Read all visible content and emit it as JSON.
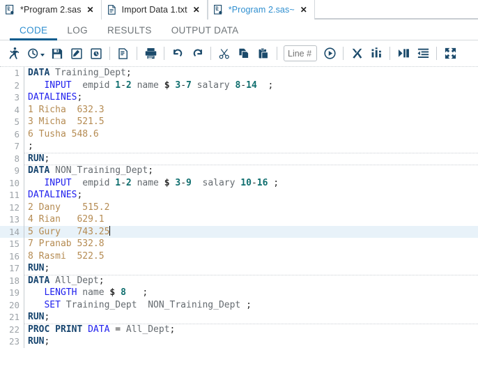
{
  "window": {
    "file_tabs": [
      {
        "label": "*Program 2.sas",
        "icon": "sas-file-icon",
        "close": "✕",
        "active": false
      },
      {
        "label": "Import Data 1.txt",
        "icon": "text-file-icon",
        "close": "✕",
        "active": false
      },
      {
        "label": "*Program 2.sas~",
        "icon": "sas-file-icon",
        "close": "✕",
        "active": true
      }
    ]
  },
  "view_tabs": [
    {
      "label": "CODE",
      "active": true
    },
    {
      "label": "LOG",
      "active": false
    },
    {
      "label": "RESULTS",
      "active": false
    },
    {
      "label": "OUTPUT DATA",
      "active": false
    }
  ],
  "toolbar": {
    "buttons": [
      {
        "name": "run-icon",
        "title": "Run"
      },
      {
        "name": "recent-history-icon",
        "title": "Recent"
      },
      {
        "name": "save-icon",
        "title": "Save"
      },
      {
        "name": "save-as-icon",
        "title": "Save As"
      },
      {
        "name": "code-snippet-icon",
        "title": "Snippets"
      },
      {
        "name": "properties-icon",
        "title": "Properties"
      },
      {
        "name": "print-icon",
        "title": "Print"
      },
      {
        "name": "undo-icon",
        "title": "Undo"
      },
      {
        "name": "redo-icon",
        "title": "Redo"
      },
      {
        "name": "cut-icon",
        "title": "Cut"
      },
      {
        "name": "copy-icon",
        "title": "Copy"
      },
      {
        "name": "paste-icon",
        "title": "Paste"
      },
      {
        "name": "go-to-line-icon",
        "title": "Go to line"
      },
      {
        "name": "clear-all-icon",
        "title": "Clear all"
      },
      {
        "name": "analyze-program-icon",
        "title": "Analyze program"
      },
      {
        "name": "add-tab-indent-icon",
        "title": "Indent"
      },
      {
        "name": "format-code-icon",
        "title": "Format code"
      },
      {
        "name": "maximize-view-icon",
        "title": "Maximize view"
      }
    ],
    "line_placeholder": "Line #",
    "line_value": ""
  },
  "editor": {
    "current_line": 14,
    "cursor_line": 14,
    "lines": [
      {
        "n": 1,
        "sep": false,
        "cur": false,
        "tokens": [
          {
            "t": "DATA",
            "c": "k-major"
          },
          {
            "t": " ",
            "c": ""
          },
          {
            "t": "Training_Dept",
            "c": "k-id"
          },
          {
            "t": ";",
            "c": "k-punct"
          }
        ]
      },
      {
        "n": 2,
        "sep": false,
        "cur": false,
        "tokens": [
          {
            "t": "   ",
            "c": ""
          },
          {
            "t": "INPUT",
            "c": "k-stmt"
          },
          {
            "t": "  ",
            "c": ""
          },
          {
            "t": "empid",
            "c": "k-id"
          },
          {
            "t": " ",
            "c": ""
          },
          {
            "t": "1",
            "c": "k-num"
          },
          {
            "t": "-",
            "c": "k-punct"
          },
          {
            "t": "2",
            "c": "k-num"
          },
          {
            "t": " ",
            "c": ""
          },
          {
            "t": "name",
            "c": "k-id"
          },
          {
            "t": " ",
            "c": ""
          },
          {
            "t": "$",
            "c": "k-dollar"
          },
          {
            "t": " ",
            "c": ""
          },
          {
            "t": "3",
            "c": "k-num"
          },
          {
            "t": "-",
            "c": "k-punct"
          },
          {
            "t": "7",
            "c": "k-num"
          },
          {
            "t": " ",
            "c": ""
          },
          {
            "t": "salary",
            "c": "k-id"
          },
          {
            "t": " ",
            "c": ""
          },
          {
            "t": "8",
            "c": "k-num"
          },
          {
            "t": "-",
            "c": "k-punct"
          },
          {
            "t": "14",
            "c": "k-num"
          },
          {
            "t": "  ",
            "c": ""
          },
          {
            "t": ";",
            "c": "k-punct"
          }
        ]
      },
      {
        "n": 3,
        "sep": false,
        "cur": false,
        "tokens": [
          {
            "t": "DATALINES",
            "c": "k-stmt"
          },
          {
            "t": ";",
            "c": "k-punct"
          }
        ]
      },
      {
        "n": 4,
        "sep": false,
        "cur": false,
        "tokens": [
          {
            "t": "1 Richa  632.3",
            "c": "k-data"
          }
        ]
      },
      {
        "n": 5,
        "sep": false,
        "cur": false,
        "tokens": [
          {
            "t": "3 Micha  521.5",
            "c": "k-data"
          }
        ]
      },
      {
        "n": 6,
        "sep": false,
        "cur": false,
        "tokens": [
          {
            "t": "6 Tusha 548.6",
            "c": "k-data"
          }
        ]
      },
      {
        "n": 7,
        "sep": false,
        "cur": false,
        "tokens": [
          {
            "t": ";",
            "c": "k-punct"
          }
        ]
      },
      {
        "n": 8,
        "sep": true,
        "cur": false,
        "tokens": [
          {
            "t": "RUN",
            "c": "k-major"
          },
          {
            "t": ";",
            "c": "k-punct"
          }
        ]
      },
      {
        "n": 9,
        "sep": true,
        "cur": false,
        "tokens": [
          {
            "t": "DATA",
            "c": "k-major"
          },
          {
            "t": " ",
            "c": ""
          },
          {
            "t": "NON_Training_Dept",
            "c": "k-id"
          },
          {
            "t": ";",
            "c": "k-punct"
          }
        ]
      },
      {
        "n": 10,
        "sep": false,
        "cur": false,
        "tokens": [
          {
            "t": "   ",
            "c": ""
          },
          {
            "t": "INPUT",
            "c": "k-stmt"
          },
          {
            "t": "  ",
            "c": ""
          },
          {
            "t": "empid",
            "c": "k-id"
          },
          {
            "t": " ",
            "c": ""
          },
          {
            "t": "1",
            "c": "k-num"
          },
          {
            "t": "-",
            "c": "k-punct"
          },
          {
            "t": "2",
            "c": "k-num"
          },
          {
            "t": " ",
            "c": ""
          },
          {
            "t": "name",
            "c": "k-id"
          },
          {
            "t": " ",
            "c": ""
          },
          {
            "t": "$",
            "c": "k-dollar"
          },
          {
            "t": " ",
            "c": ""
          },
          {
            "t": "3",
            "c": "k-num"
          },
          {
            "t": "-",
            "c": "k-punct"
          },
          {
            "t": "9",
            "c": "k-num"
          },
          {
            "t": "  ",
            "c": ""
          },
          {
            "t": "salary",
            "c": "k-id"
          },
          {
            "t": " ",
            "c": ""
          },
          {
            "t": "10",
            "c": "k-num"
          },
          {
            "t": "-",
            "c": "k-punct"
          },
          {
            "t": "16",
            "c": "k-num"
          },
          {
            "t": " ",
            "c": ""
          },
          {
            "t": ";",
            "c": "k-punct"
          }
        ]
      },
      {
        "n": 11,
        "sep": false,
        "cur": false,
        "tokens": [
          {
            "t": "DATALINES",
            "c": "k-stmt"
          },
          {
            "t": ";",
            "c": "k-punct"
          }
        ]
      },
      {
        "n": 12,
        "sep": false,
        "cur": false,
        "tokens": [
          {
            "t": "2 Dany    515.2",
            "c": "k-data"
          }
        ]
      },
      {
        "n": 13,
        "sep": false,
        "cur": false,
        "tokens": [
          {
            "t": "4 Rian   629.1",
            "c": "k-data"
          }
        ]
      },
      {
        "n": 14,
        "sep": false,
        "cur": true,
        "tokens": [
          {
            "t": "5 Gury   743.25",
            "c": "k-data"
          }
        ]
      },
      {
        "n": 15,
        "sep": false,
        "cur": false,
        "tokens": [
          {
            "t": "7 Pranab 532.8",
            "c": "k-data"
          }
        ]
      },
      {
        "n": 16,
        "sep": false,
        "cur": false,
        "tokens": [
          {
            "t": "8 Rasmi  522.5",
            "c": "k-data"
          }
        ]
      },
      {
        "n": 17,
        "sep": false,
        "cur": false,
        "tokens": [
          {
            "t": "RUN",
            "c": "k-major"
          },
          {
            "t": ";",
            "c": "k-punct"
          }
        ]
      },
      {
        "n": 18,
        "sep": true,
        "cur": false,
        "tokens": [
          {
            "t": "DATA",
            "c": "k-major"
          },
          {
            "t": " ",
            "c": ""
          },
          {
            "t": "All_Dept",
            "c": "k-id"
          },
          {
            "t": ";",
            "c": "k-punct"
          }
        ]
      },
      {
        "n": 19,
        "sep": false,
        "cur": false,
        "tokens": [
          {
            "t": "   ",
            "c": ""
          },
          {
            "t": "LENGTH",
            "c": "k-stmt"
          },
          {
            "t": " ",
            "c": ""
          },
          {
            "t": "name",
            "c": "k-id"
          },
          {
            "t": " ",
            "c": ""
          },
          {
            "t": "$",
            "c": "k-dollar"
          },
          {
            "t": " ",
            "c": ""
          },
          {
            "t": "8",
            "c": "k-num"
          },
          {
            "t": "   ",
            "c": ""
          },
          {
            "t": ";",
            "c": "k-punct"
          }
        ]
      },
      {
        "n": 20,
        "sep": false,
        "cur": false,
        "tokens": [
          {
            "t": "   ",
            "c": ""
          },
          {
            "t": "SET",
            "c": "k-stmt"
          },
          {
            "t": " ",
            "c": ""
          },
          {
            "t": "Training_Dept",
            "c": "k-id"
          },
          {
            "t": "  ",
            "c": ""
          },
          {
            "t": "NON_Training_Dept",
            "c": "k-id"
          },
          {
            "t": " ",
            "c": ""
          },
          {
            "t": ";",
            "c": "k-punct"
          }
        ]
      },
      {
        "n": 21,
        "sep": false,
        "cur": false,
        "tokens": [
          {
            "t": "RUN",
            "c": "k-major"
          },
          {
            "t": ";",
            "c": "k-punct"
          }
        ]
      },
      {
        "n": 22,
        "sep": true,
        "cur": false,
        "tokens": [
          {
            "t": "PROC PRINT",
            "c": "k-major"
          },
          {
            "t": " ",
            "c": ""
          },
          {
            "t": "DATA",
            "c": "k-opt"
          },
          {
            "t": " = ",
            "c": "k-punct"
          },
          {
            "t": "All_Dept",
            "c": "k-id"
          },
          {
            "t": ";",
            "c": "k-punct"
          }
        ]
      },
      {
        "n": 23,
        "sep": false,
        "cur": false,
        "tokens": [
          {
            "t": "RUN",
            "c": "k-major"
          },
          {
            "t": ";",
            "c": "k-punct"
          }
        ]
      }
    ]
  },
  "colors": {
    "accent_blue": "#2f8fd0",
    "tab_underline": "#0b5c8e",
    "keyword_major": "#16446e",
    "keyword_stmt": "#2020ee",
    "number": "#0f6e6e",
    "identifier": "#646a6f",
    "datalines_text": "#b58b52",
    "current_line_bg": "#e8f2f9"
  }
}
